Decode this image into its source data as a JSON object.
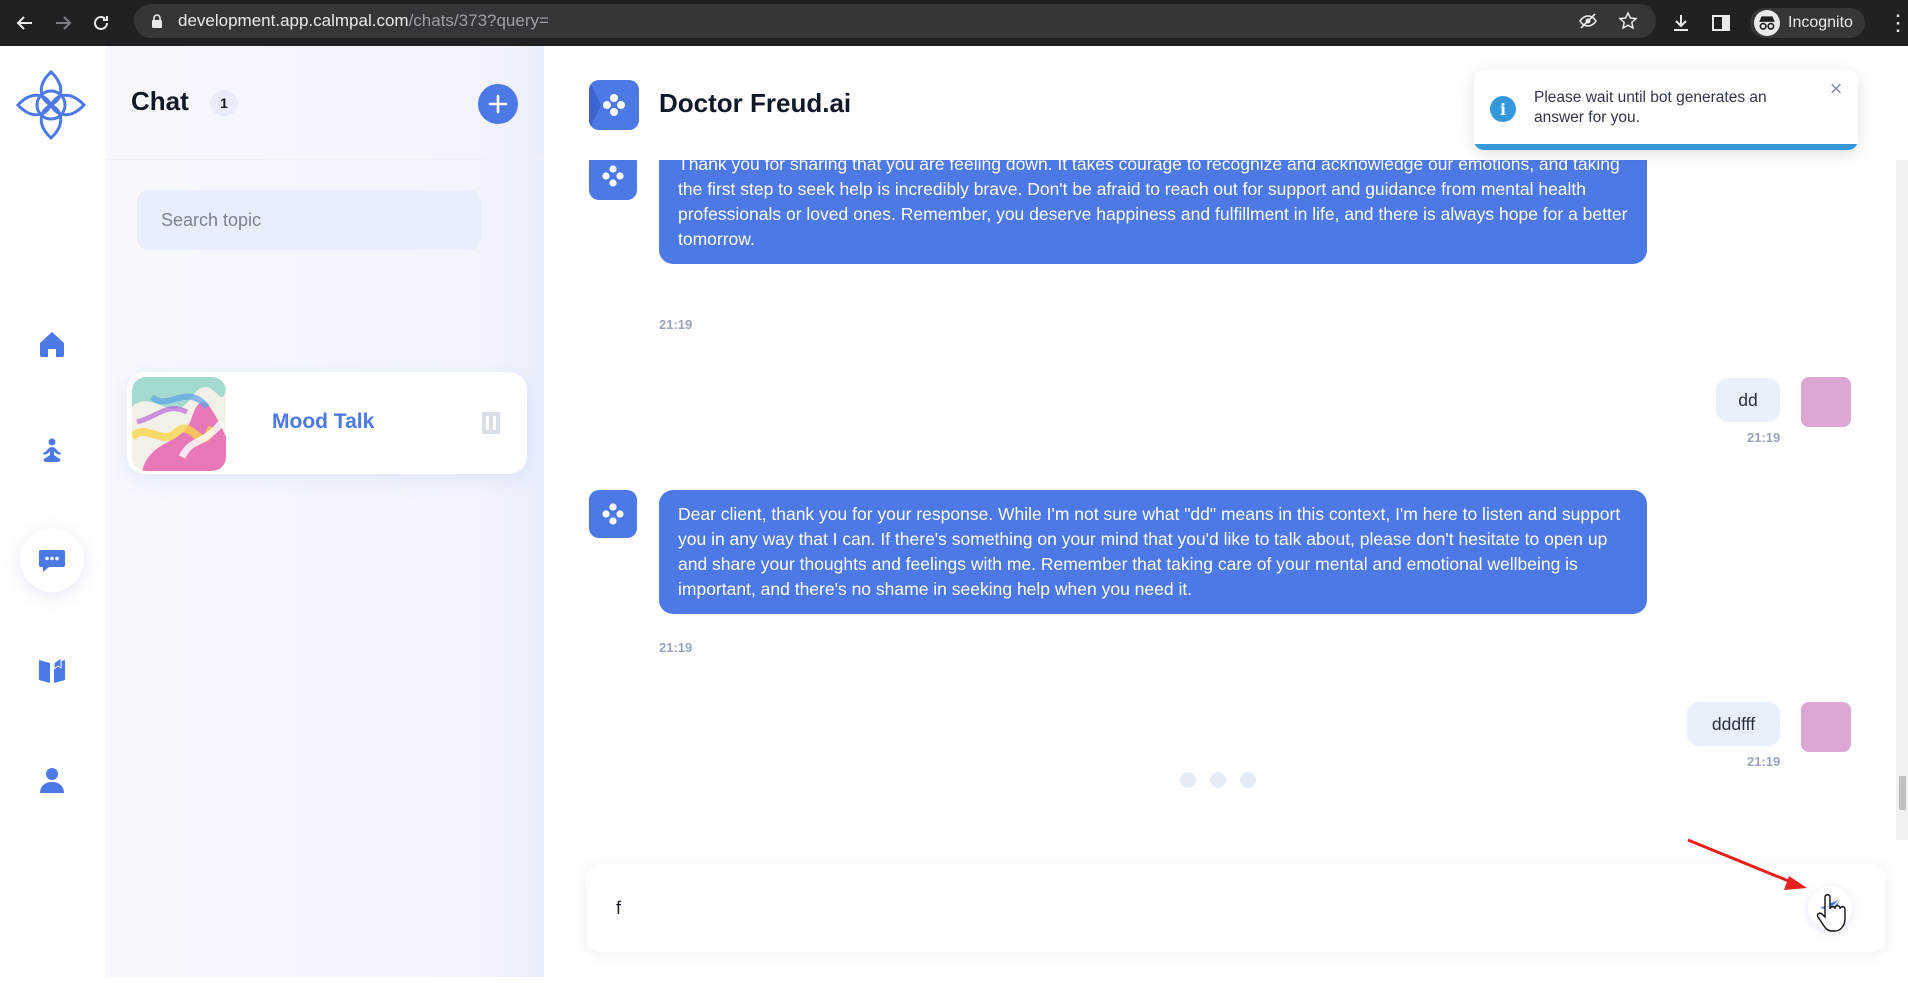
{
  "browser": {
    "url_host": "development.app.calmpal.com",
    "url_path": "/chats/373?query=",
    "incognito_label": "Incognito"
  },
  "sidebar": {
    "title": "Chat",
    "count": "1",
    "search_placeholder": "Search topic",
    "chats": [
      {
        "name": "Mood Talk"
      }
    ]
  },
  "rail": {
    "items": [
      "home",
      "meditation",
      "chat",
      "journal",
      "profile"
    ],
    "active": "chat"
  },
  "main": {
    "bot_name": "Doctor Freud.ai",
    "messages": [
      {
        "from": "bot",
        "text": "Thank you for sharing that you are feeling down. It takes courage to recognize and acknowledge our emotions, and taking the first step to seek help is incredibly brave. Don't be afraid to reach out for support and guidance from mental health professionals or loved ones. Remember, you deserve happiness and fulfillment in life, and there is always hope for a better tomorrow.",
        "time": "21:19"
      },
      {
        "from": "user",
        "text": "dd",
        "time": "21:19"
      },
      {
        "from": "bot",
        "text": "Dear client, thank you for your response. While I'm not sure what \"dd\" means in this context, I'm here to listen and support you in any way that I can. If there's something on your mind that you'd like to talk about, please don't hesitate to open up and share your thoughts and feelings with me. Remember that taking care of your mental and emotional wellbeing is important, and there's no shame in seeking help when you need it.",
        "time": "21:19"
      },
      {
        "from": "user",
        "text": "dddfff",
        "time": "21:19"
      }
    ],
    "composer_value": "f"
  },
  "toast": {
    "text": "Please wait until bot generates an answer for you.",
    "close_label": "×"
  },
  "colors": {
    "accent": "#4d79e6",
    "info": "#3498db",
    "user_avatar": "#dea6d3",
    "annotation_arrow": "#e8211f"
  }
}
